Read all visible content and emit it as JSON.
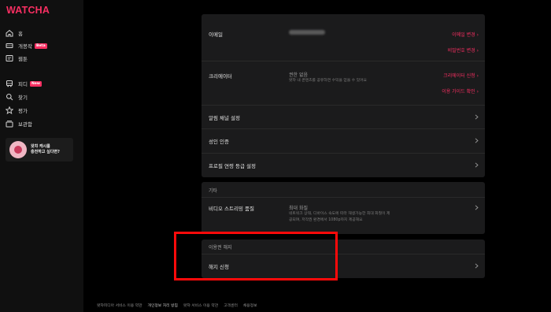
{
  "app": {
    "logo": "WATCHA"
  },
  "sidebar": {
    "items": [
      {
        "label": "홈",
        "icon": "home-icon"
      },
      {
        "label": "개봉작",
        "icon": "ticket-icon",
        "badge": "Beta"
      },
      {
        "label": "웹툰",
        "icon": "webtoon-icon"
      },
      {
        "label": "피디",
        "icon": "bus-icon",
        "badge": "New"
      },
      {
        "label": "찾기",
        "icon": "search-icon"
      },
      {
        "label": "평가",
        "icon": "star-icon"
      },
      {
        "label": "보관함",
        "icon": "library-icon"
      }
    ],
    "promo": {
      "line1": "왓챠 캐시를",
      "line2": "충전하고 싶다면?"
    }
  },
  "account": {
    "email": {
      "label": "이메일",
      "change": "이메일 변경",
      "password_change": "비밀번호 변경"
    },
    "creator": {
      "label": "크리에이터",
      "value": "권한 없음",
      "desc": "왓챠 내 콘텐츠를 공유하면 수익을 얻을 수 있어요",
      "apply": "크리에이터 신청",
      "guide": "이용 가이드 확인"
    },
    "notification": {
      "label": "알림 채널 설정"
    },
    "adult": {
      "label": "성인 인증"
    },
    "profile_age": {
      "label": "프로필 연령 등급 설정"
    }
  },
  "etc": {
    "title": "기타",
    "video": {
      "label": "비디오 스트리밍 품질",
      "value": "최대 화질",
      "desc1": "네트워크 상태, 디바이스 속도에 따라 재생가능한 최대 화질이 제",
      "desc2": "공되며, 저작권 환경에서 1080p까지 제공해요"
    }
  },
  "cancel": {
    "title": "이용권 해지",
    "request": "해지 신청"
  },
  "footer": {
    "links": [
      "왓챠피디아 서비스 이용 약관",
      "개인정보 처리 방침",
      "왓챠 서비스 이용 약관",
      "고객센터",
      "채용정보"
    ]
  },
  "colors": {
    "accent": "#f82f62",
    "highlight": "#ff0a0a",
    "panel": "#1b1b1c",
    "sidebar": "#101010"
  }
}
